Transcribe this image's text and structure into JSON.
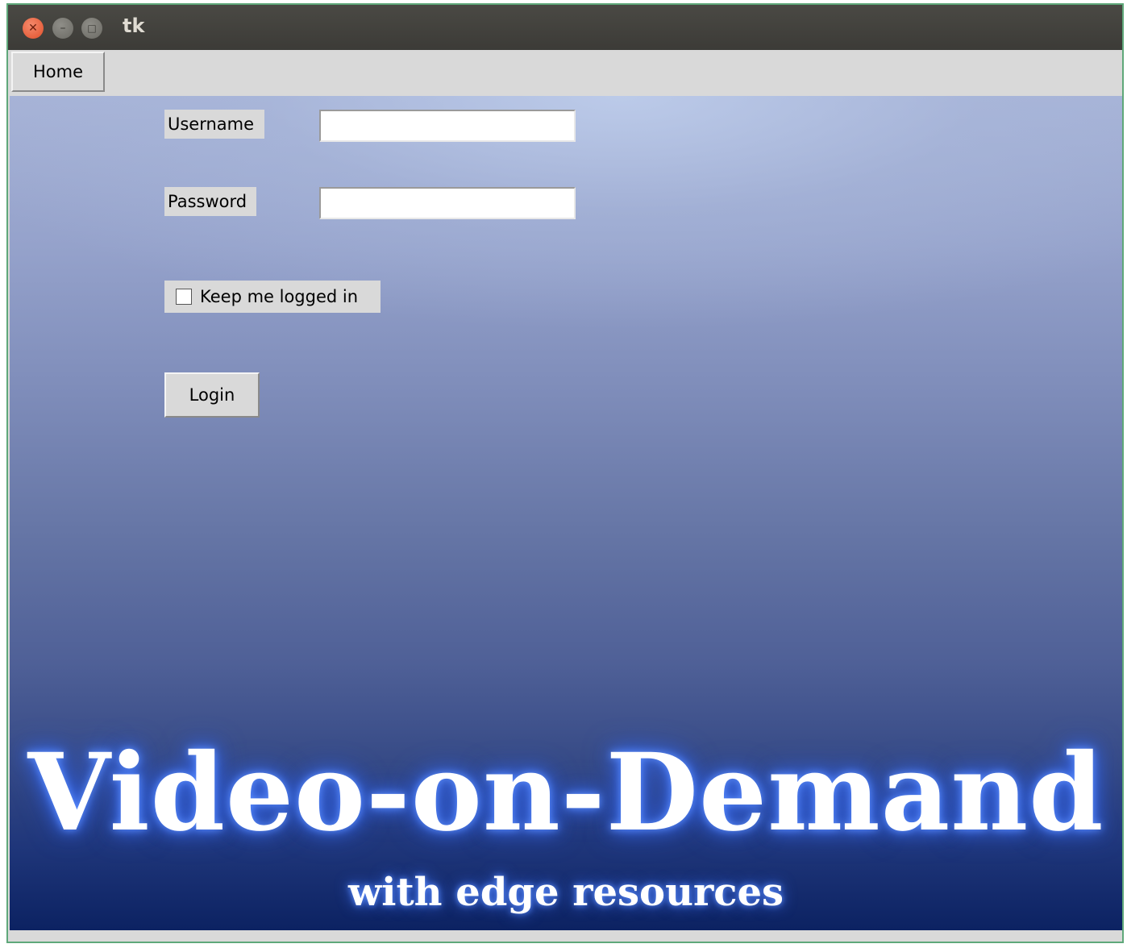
{
  "window": {
    "title": "tk",
    "controls": [
      "close-icon",
      "minimize-icon",
      "maximize-icon"
    ]
  },
  "menu": {
    "home_label": "Home"
  },
  "form": {
    "username_label": "Username",
    "username_value": "",
    "password_label": "Password",
    "password_value": "",
    "keep_logged_in_label": "Keep me logged in",
    "keep_logged_in_checked": false,
    "login_label": "Login"
  },
  "branding": {
    "title": "Video-on-Demand",
    "subtitle": "with edge resources"
  },
  "colors": {
    "titlebar": "#3c3b37",
    "close_button": "#e1502b",
    "widget_bg": "#d9d9d9",
    "window_border": "#5fa87a",
    "background_top": "#a6b2d6",
    "background_bottom": "#0c2262",
    "brand_glow": "#3a6cf0"
  }
}
